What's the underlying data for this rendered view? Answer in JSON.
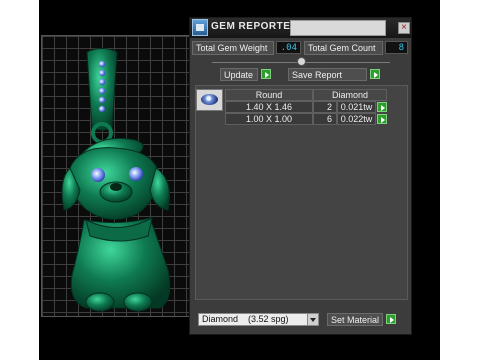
{
  "dialog": {
    "title": "GEM REPORTER",
    "close_label": "×"
  },
  "stats": {
    "weight_label": "Total Gem Weight",
    "weight_value": ".04",
    "count_label": "Total Gem Count",
    "count_value": "8"
  },
  "actions": {
    "update_label": "Update",
    "save_label": "Save Report"
  },
  "gem_table": {
    "shape_header": "Round",
    "material_header": "Diamond",
    "rows": [
      {
        "size": "1.40 X 1.46",
        "count": "2",
        "weight": "0.021tw"
      },
      {
        "size": "1.00 X 1.00",
        "count": "6",
        "weight": "0.022tw"
      }
    ]
  },
  "material": {
    "selected": "Diamond    (3.52 spg)",
    "set_label": "Set Material"
  },
  "colors": {
    "model_green": "#0f7a52",
    "accent_cyan": "#34c3e6",
    "go_green": "#2d9e2d"
  },
  "icons": {
    "logo": "app-logo-icon",
    "close": "close-icon",
    "go": "green-arrow-icon",
    "gem": "round-gem-icon"
  }
}
